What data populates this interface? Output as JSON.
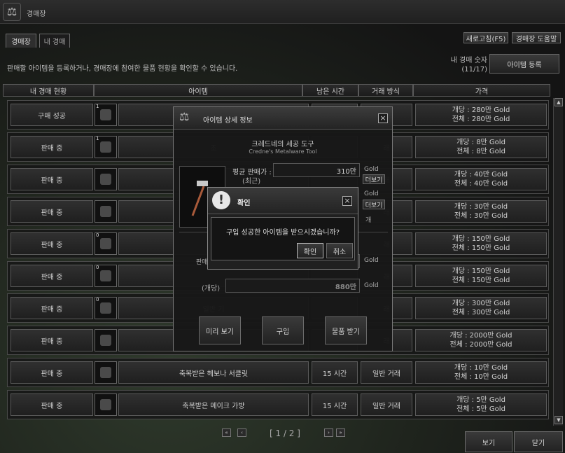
{
  "window": {
    "title": "경매장"
  },
  "tabs": [
    {
      "label": "경매장"
    },
    {
      "label": "내 경매"
    }
  ],
  "toolbar": {
    "refresh_label": "새로고침(F5)",
    "help_label": "경매장 도움말",
    "register_label": "아이템 등록"
  },
  "description": "판매할 아이템을 등록하거나, 경매장에 참여한 물품 현황을 확인할 수 있습니다.",
  "auction_count": {
    "label": "내 경매 숫자",
    "value": "(11/17)"
  },
  "columns": [
    "내 경매 현황",
    "아이템",
    "남은 시간",
    "거래 방식",
    "가격"
  ],
  "rows": [
    {
      "status": "구매 성공",
      "name": "",
      "time": "",
      "type": "래",
      "price_unit": "개당 : 280만 Gold",
      "price_total": "전체 : 280만 Gold",
      "qty": "1",
      "icon": "hammer-icon"
    },
    {
      "status": "판매 중",
      "name": "조",
      "time": "",
      "type": "래",
      "price_unit": "개당 : 8만 Gold",
      "price_total": "전체 : 8만 Gold",
      "qty": "1",
      "icon": "ticket-icon"
    },
    {
      "status": "판매 중",
      "name": "",
      "time": "",
      "type": "래",
      "price_unit": "개당 : 40만 Gold",
      "price_total": "전체 : 40만 Gold",
      "qty": "",
      "icon": "potion-icon"
    },
    {
      "status": "판매 중",
      "name": "일반 기사단의 훈",
      "time": "",
      "type": "래",
      "price_unit": "개당 : 30만 Gold",
      "price_total": "전체 : 30만 Gold",
      "qty": "",
      "icon": "medal-icon"
    },
    {
      "status": "판매 중",
      "name": "",
      "time": "",
      "type": "래",
      "price_unit": "개당 : 150만 Gold",
      "price_total": "전체 : 150만 Gold",
      "qty": "0",
      "icon": "cloth-icon"
    },
    {
      "status": "판매 중",
      "name": "",
      "time": "",
      "type": "래",
      "price_unit": "개당 : 150만 Gold",
      "price_total": "전체 : 150만 Gold",
      "qty": "0",
      "icon": "bundle-icon"
    },
    {
      "status": "판매 중",
      "name": "일반 기",
      "time": "",
      "type": "래",
      "price_unit": "개당 : 300만 Gold",
      "price_total": "전체 : 300만 Gold",
      "qty": "0",
      "icon": "gem-icon"
    },
    {
      "status": "판매 중",
      "name": "축복받",
      "time": "",
      "type": "래",
      "price_unit": "개당 : 2000만 Gold",
      "price_total": "전체 : 2000만 Gold",
      "qty": "",
      "icon": "needle-icon"
    },
    {
      "status": "판매 중",
      "name": "축복받은 헤보나 서클릿",
      "time": "15 시간",
      "type": "일반 거래",
      "price_unit": "개당 : 10만 Gold",
      "price_total": "전체 : 10만 Gold",
      "qty": "",
      "icon": "circlet-icon"
    },
    {
      "status": "판매 중",
      "name": "축복받은 메이크 가방",
      "time": "15 시간",
      "type": "일반 거래",
      "price_unit": "개당 : 5만 Gold",
      "price_total": "전체 : 5만 Gold",
      "qty": "",
      "icon": "bag-icon"
    }
  ],
  "pagination": {
    "text": "[ 1 / 2 ]"
  },
  "bottom": {
    "view_label": "보기",
    "close_label": "닫기"
  },
  "detail_dialog": {
    "title": "아이템 상세 정보",
    "item_name": "크레드네의 세공 도구",
    "item_name_en": "Credne's Metalware Tool",
    "avg_label": "평균 판매가 :",
    "avg_sub": "(최근)",
    "avg_value": "310만",
    "gold": "Gold",
    "more": "더보기",
    "type_fragment": "개",
    "sell_fragment": "판매",
    "unit_label": "(개당)",
    "unit_value": "880만",
    "buttons": {
      "preview": "미리 보기",
      "buy": "구입",
      "receive": "물품 받기"
    }
  },
  "confirm_dialog": {
    "title": "확인",
    "message": "구입 성공한 아이템을 받으시겠습니까?",
    "ok": "확인",
    "cancel": "취소"
  }
}
